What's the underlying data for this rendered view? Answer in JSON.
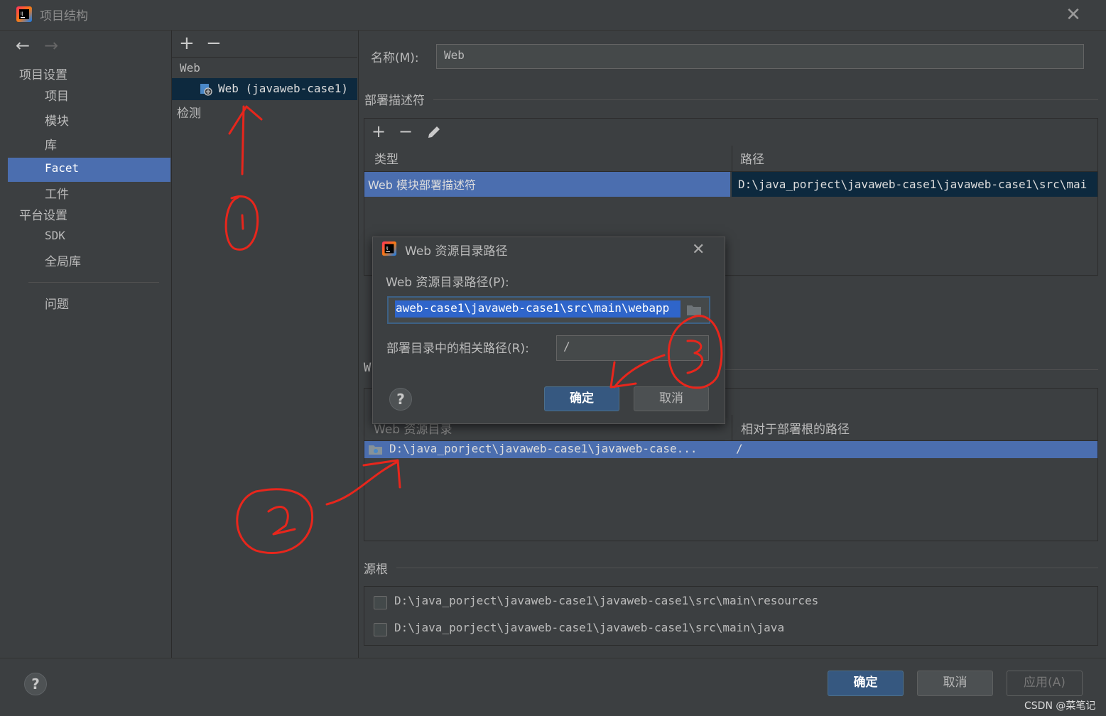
{
  "window": {
    "title": "项目结构"
  },
  "nav": {
    "back": "←",
    "forward": "→",
    "project_settings": "项目设置",
    "items": [
      "项目",
      "模块",
      "库",
      "Facet",
      "工件"
    ],
    "platform_settings": "平台设置",
    "platform_items": [
      "SDK",
      "全局库"
    ],
    "problems": "问题"
  },
  "facets": {
    "add": "+",
    "remove": "−",
    "group": "Web",
    "item": "Web (javaweb-case1)",
    "detect": "检测"
  },
  "facet": {
    "name_label": "名称(M):",
    "name_value": "Web",
    "deploy_title": "部署描述符",
    "deploy_columns": [
      "类型",
      "路径"
    ],
    "deploy_row": {
      "type": "Web 模块部署描述符",
      "path": "D:\\java_porject\\javaweb-case1\\javaweb-case1\\src\\mai"
    },
    "web_res_title_partial": "W",
    "web_res_columns": [
      "Web 资源目录",
      "相对于部署根的路径"
    ],
    "web_res_row": {
      "dir": "D:\\java_porject\\javaweb-case1\\javaweb-case...",
      "rel": "/"
    },
    "source_roots_title": "源根",
    "source_roots": [
      "D:\\java_porject\\javaweb-case1\\javaweb-case1\\src\\main\\resources",
      "D:\\java_porject\\javaweb-case1\\javaweb-case1\\src\\main\\java"
    ]
  },
  "dialog": {
    "title": "Web 资源目录路径",
    "path_label": "Web 资源目录路径(P):",
    "path_value": "aweb-case1\\javaweb-case1\\src\\main\\webapp",
    "rel_label": "部署目录中的相关路径(R):",
    "rel_value": "/",
    "ok": "确定",
    "cancel": "取消",
    "help": "?"
  },
  "footer": {
    "help": "?",
    "ok": "确定",
    "cancel": "取消",
    "apply": "应用(A)",
    "watermark": "CSDN @菜笔记"
  },
  "annotations": [
    "1",
    "2",
    "3"
  ]
}
